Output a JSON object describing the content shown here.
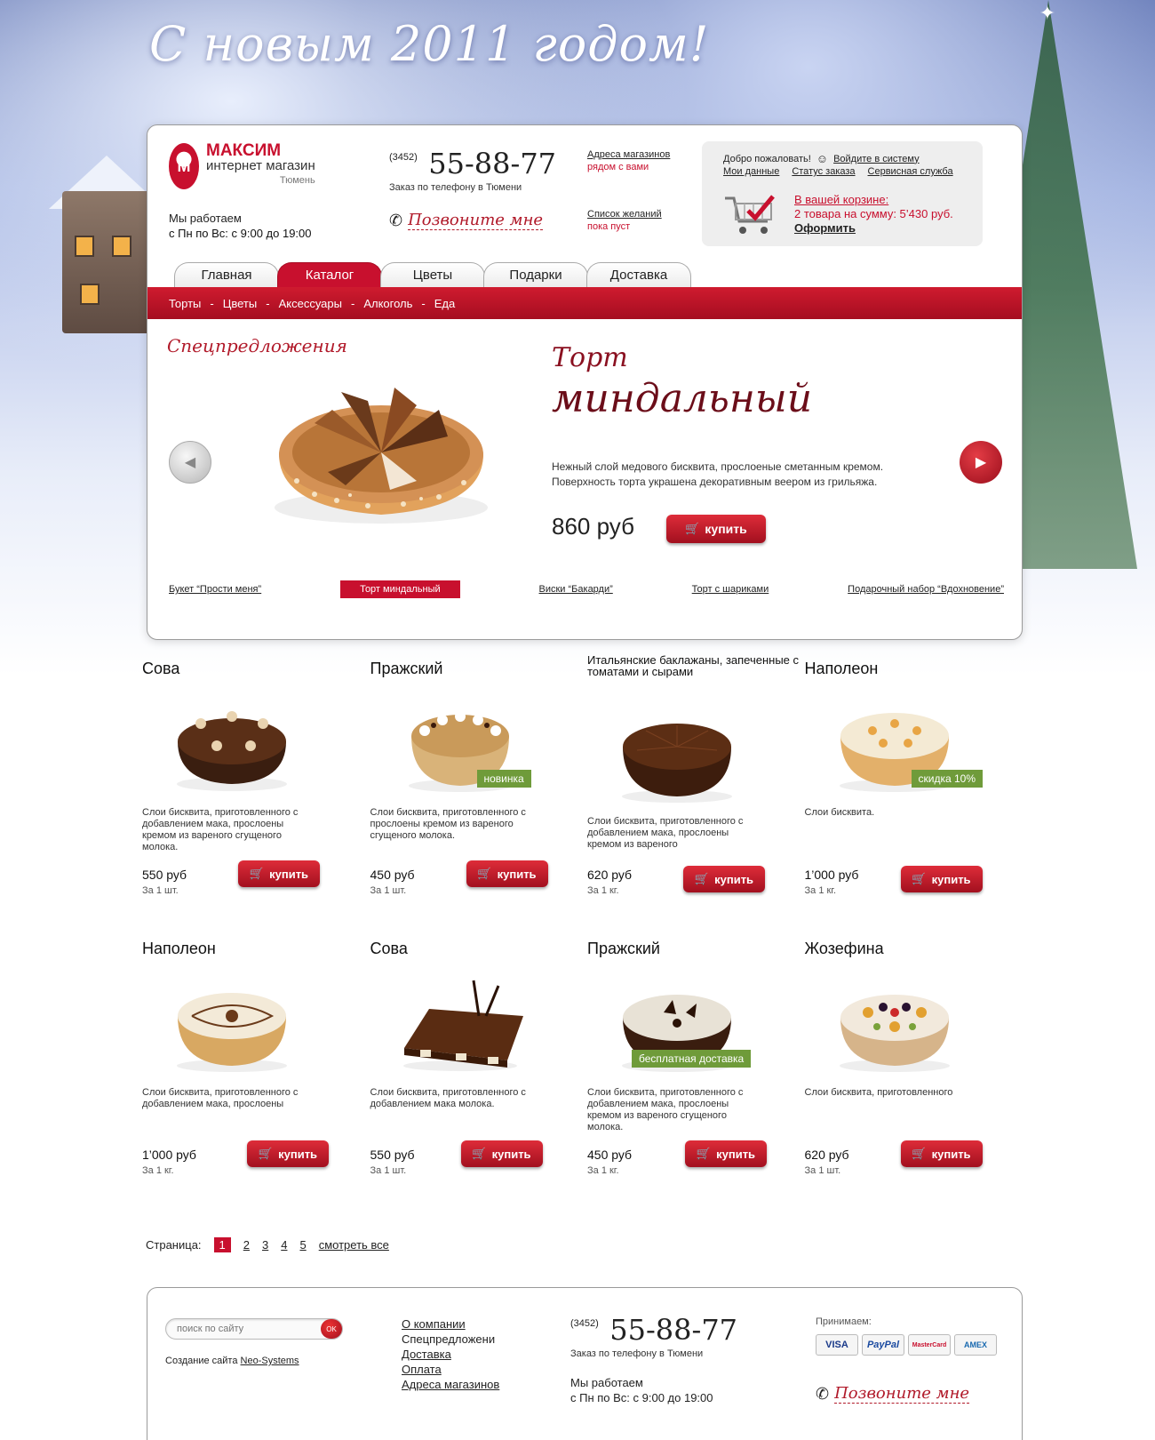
{
  "greeting": "С новым 2011 годом!",
  "logo": {
    "title": "МАКСИМ",
    "subtitle": "интернет магазин",
    "city": "Тюмень"
  },
  "hours": {
    "line1": "Мы работаем",
    "line2": "с Пн по Вс: с 9:00 до 19:00"
  },
  "phone": {
    "code": "(3452)",
    "number": "55-88-77",
    "note": "Заказ по телефону в Тюмени"
  },
  "callme": "Позвоните мне",
  "shops": {
    "label": "Адреса магазинов",
    "sub": "рядом с вами"
  },
  "wishlist": {
    "label": "Список желаний",
    "sub": "пока пуст"
  },
  "account": {
    "welcome": "Добро пожаловать!",
    "login": "Войдите в систему",
    "my_data": "Мои данные",
    "order_status": "Статус заказа",
    "service": "Сервисная служба"
  },
  "cart": {
    "title": "В вашей корзине:",
    "summary": "2 товара на сумму: 5’430 руб.",
    "checkout": "Оформить"
  },
  "tabs": [
    {
      "label": "Главная"
    },
    {
      "label": "Каталог"
    },
    {
      "label": "Цветы"
    },
    {
      "label": "Подарки"
    },
    {
      "label": "Доставка"
    }
  ],
  "subnav": [
    "Торты",
    "Цветы",
    "Аксессуары",
    "Алкоголь",
    "Еда"
  ],
  "subnav_sep": "-",
  "promo": {
    "heading": "Спецпредложения",
    "title1": "Торт",
    "title2": "миндальный",
    "description": "Нежный слой медового бисквита, прослоеные сметанным кремом. Поверхность торта украшена декоративным веером из грильяжа.",
    "price": "860 руб",
    "buy": "купить",
    "slides": [
      "Букет “Прости меня”",
      "Торт миндальный",
      "Виски “Бакарди”",
      "Торт с шариками",
      "Подарочный набор “Вдохновение”"
    ],
    "active_slide": 1
  },
  "products_row1": [
    {
      "name": "Сова",
      "badge": "",
      "desc": "Слои бисквита, приготовленного с добавлением мака, прослоены кремом из вареного сгущеного молока.",
      "price": "550 руб",
      "unit": "За 1 шт.",
      "buy": "купить"
    },
    {
      "name": "Пражский",
      "badge": "новинка",
      "desc": "Слои бисквита, приготовленного с прослоены кремом из вареного сгущеного молока.",
      "price": "450 руб",
      "unit": "За 1 шт.",
      "buy": "купить"
    },
    {
      "name": "Итальянские баклажаны, запеченные с томатами и сырами",
      "badge": "",
      "desc": "Слои бисквита, приготовленного с добавлением мака, прослоены кремом из вареного",
      "price": "620 руб",
      "unit": "За 1 кг.",
      "buy": "купить"
    },
    {
      "name": "Наполеон",
      "badge": "скидка 10%",
      "desc": "Слои бисквита.",
      "price": "1’000 руб",
      "unit": "За 1 кг.",
      "buy": "купить"
    }
  ],
  "products_row2": [
    {
      "name": "Наполеон",
      "badge": "",
      "desc": "Слои бисквита, приготовленного с добавлением мака, прослоены",
      "price": "1’000 руб",
      "unit": "За 1 кг.",
      "buy": "купить"
    },
    {
      "name": "Сова",
      "badge": "",
      "desc": "Слои бисквита, приготовленного с добавлением мака молока.",
      "price": "550 руб",
      "unit": "За 1 шт.",
      "buy": "купить"
    },
    {
      "name": "Пражский",
      "badge": "бесплатная доставка",
      "desc": "Слои бисквита, приготовленного с добавлением мака, прослоены кремом из вареного сгущеного молока.",
      "price": "450 руб",
      "unit": "За 1 кг.",
      "buy": "купить"
    },
    {
      "name": "Жозефина",
      "badge": "",
      "desc": "Слои бисквита, приготовленного",
      "price": "620 руб",
      "unit": "За 1 шт.",
      "buy": "купить"
    }
  ],
  "pager": {
    "label": "Страница:",
    "pages": [
      "1",
      "2",
      "3",
      "4",
      "5"
    ],
    "all": "смотреть все",
    "current": "1"
  },
  "footer": {
    "search_placeholder": "поиск по сайту",
    "search_ok": "OK",
    "credits_prefix": "Создание сайта",
    "credits_link": "Neo-Systems",
    "nav": [
      "О компании",
      "Спецпредложени",
      "Доставка",
      "Оплата",
      "Адреса магазинов"
    ],
    "phone_code": "(3452)",
    "phone_number": "55-88-77",
    "phone_note": "Заказ по телефону в Тюмени",
    "hours1": "Мы работаем",
    "hours2": "с Пн по Вс: с 9:00 до 19:00",
    "accepts": "Принимаем:",
    "payments": [
      "VISA",
      "PayPal",
      "MasterCard",
      "AMEX"
    ],
    "callme": "Позвоните мне"
  },
  "colors": {
    "brand_red": "#c8102e",
    "badge_green": "#6f9b3a"
  },
  "icons": [
    "phone-icon",
    "cart-icon",
    "user-icon",
    "arrow-left-icon",
    "arrow-right-icon"
  ]
}
